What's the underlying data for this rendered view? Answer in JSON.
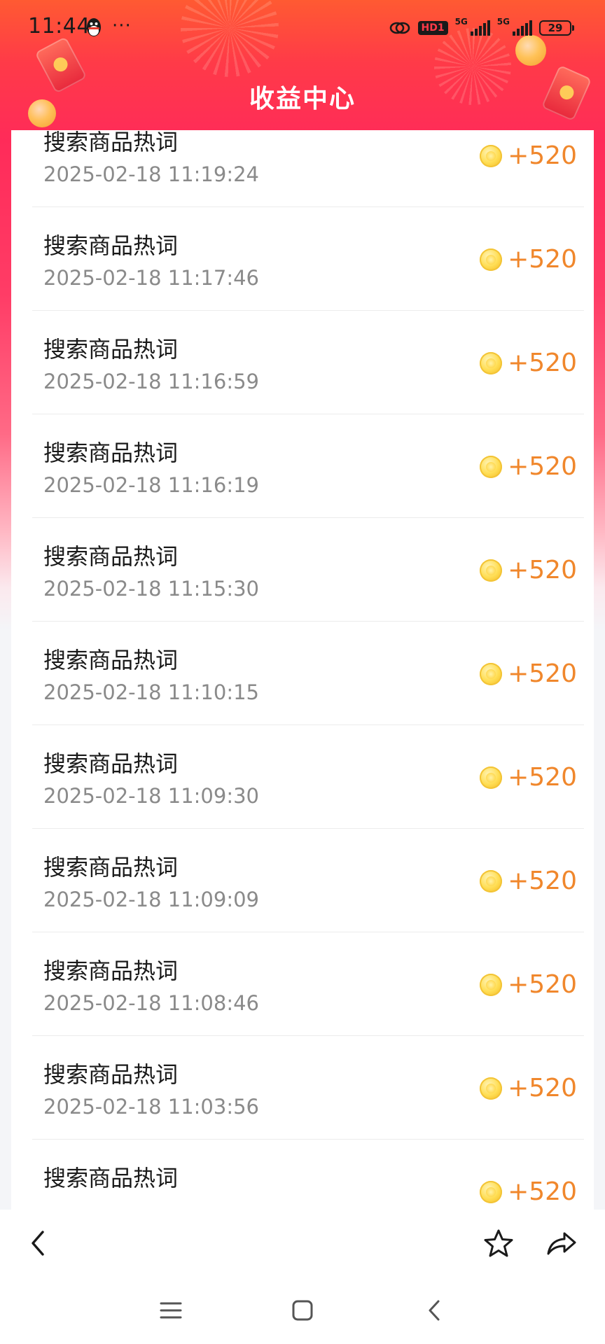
{
  "status_bar": {
    "time": "11:44",
    "more": "···",
    "hd_badge": "HD1",
    "network_1": "5G",
    "network_2": "5G",
    "battery": "29"
  },
  "header": {
    "title": "收益中心"
  },
  "records": [
    {
      "title": "搜索商品热词",
      "time": "2025-02-18 11:19:24",
      "amount": "+520"
    },
    {
      "title": "搜索商品热词",
      "time": "2025-02-18 11:17:46",
      "amount": "+520"
    },
    {
      "title": "搜索商品热词",
      "time": "2025-02-18 11:16:59",
      "amount": "+520"
    },
    {
      "title": "搜索商品热词",
      "time": "2025-02-18 11:16:19",
      "amount": "+520"
    },
    {
      "title": "搜索商品热词",
      "time": "2025-02-18 11:15:30",
      "amount": "+520"
    },
    {
      "title": "搜索商品热词",
      "time": "2025-02-18 11:10:15",
      "amount": "+520"
    },
    {
      "title": "搜索商品热词",
      "time": "2025-02-18 11:09:30",
      "amount": "+520"
    },
    {
      "title": "搜索商品热词",
      "time": "2025-02-18 11:09:09",
      "amount": "+520"
    },
    {
      "title": "搜索商品热词",
      "time": "2025-02-18 11:08:46",
      "amount": "+520"
    },
    {
      "title": "搜索商品热词",
      "time": "2025-02-18 11:03:56",
      "amount": "+520"
    },
    {
      "title": "搜索商品热词",
      "time": "",
      "amount": "+520"
    }
  ],
  "icons": {
    "reward": "coin-icon",
    "back": "chevron-left-icon",
    "favorite": "star-icon",
    "share": "share-icon",
    "menu": "menu-icon",
    "home": "square-home-icon",
    "system_back": "chevron-left-icon"
  },
  "colors": {
    "header_gradient_top": "#ff5a32",
    "header_gradient_mid": "#ff2b59",
    "reward_orange": "#f0872c",
    "page_background": "#f4f5f8"
  }
}
